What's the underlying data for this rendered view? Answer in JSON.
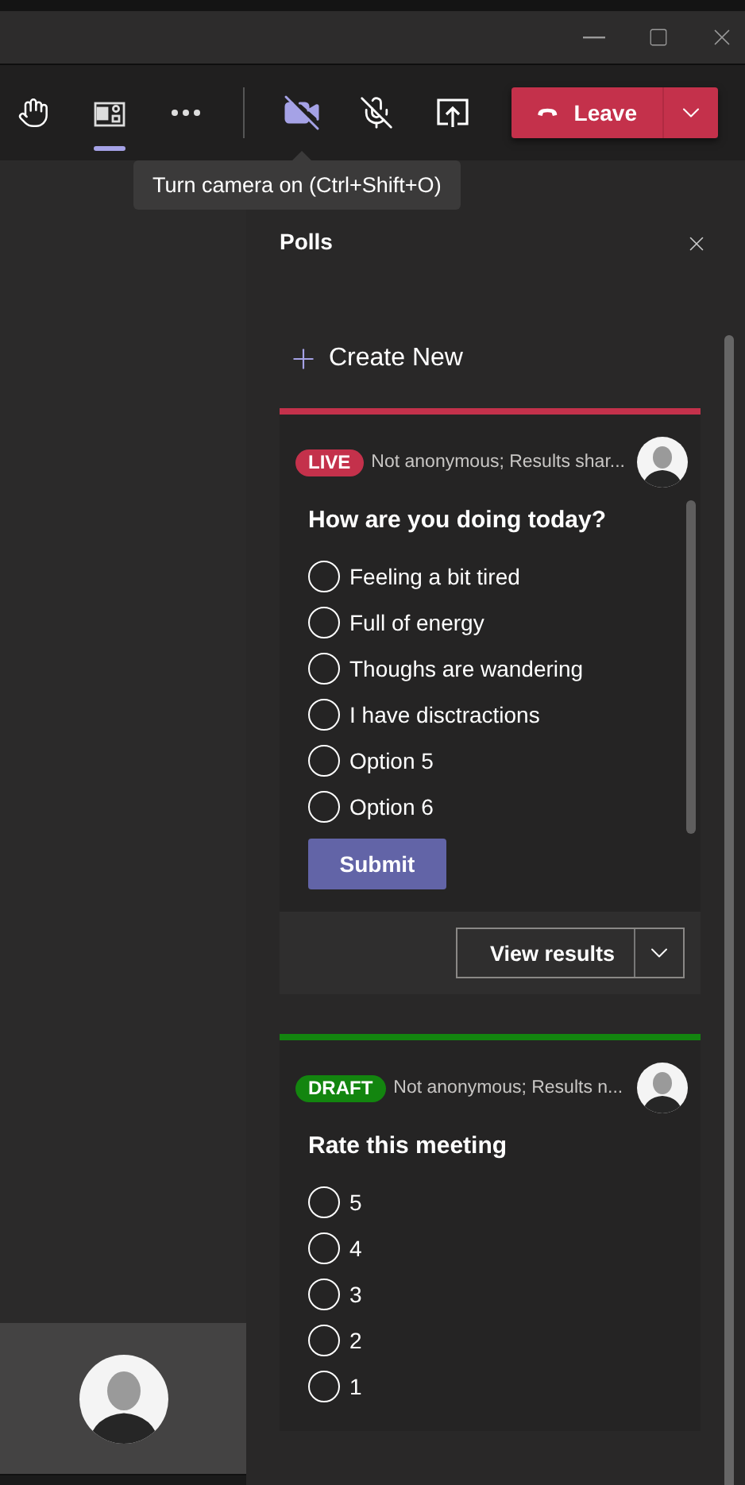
{
  "toolbar": {
    "camera_on": false,
    "mic_on": false,
    "leave": {
      "label": "Leave"
    }
  },
  "tooltip": {
    "text": "Turn camera on (Ctrl+Shift+O)"
  },
  "panel": {
    "title": "Polls",
    "create": {
      "label": "Create New"
    },
    "polls": [
      {
        "status": {
          "label": "LIVE",
          "color": "#c4314b"
        },
        "meta": "Not anonymous; Results shar...",
        "question": "How are you doing today?",
        "options": [
          {
            "label": "Feeling a bit tired",
            "selected": false
          },
          {
            "label": "Full of energy",
            "selected": false
          },
          {
            "label": "Thoughs are wandering",
            "selected": false
          },
          {
            "label": "I have disctractions",
            "selected": false
          },
          {
            "label": "Option 5",
            "selected": false
          },
          {
            "label": "Option 6",
            "selected": false
          }
        ],
        "submit": "Submit",
        "results_button": "View results"
      },
      {
        "status": {
          "label": "DRAFT",
          "color": "#13850f"
        },
        "meta": "Not anonymous; Results n...",
        "question": "Rate this meeting",
        "options": [
          {
            "label": "5",
            "selected": false
          },
          {
            "label": "4",
            "selected": false
          },
          {
            "label": "3",
            "selected": false
          },
          {
            "label": "2",
            "selected": false
          },
          {
            "label": "1",
            "selected": false
          }
        ]
      }
    ]
  }
}
